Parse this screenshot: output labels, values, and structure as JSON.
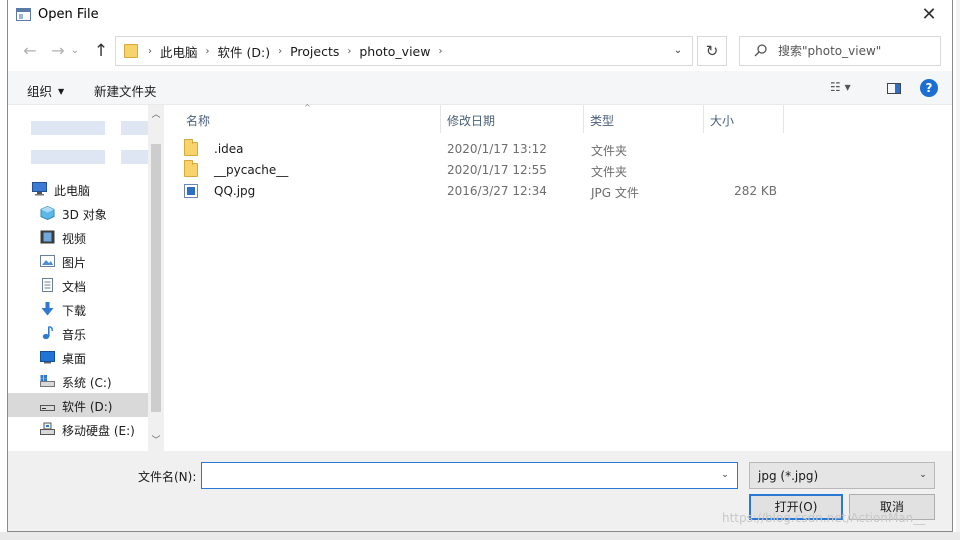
{
  "window": {
    "title": "Open File",
    "close_glyph": "✕"
  },
  "nav": {
    "back_glyph": "←",
    "forward_glyph": "→",
    "recent_glyph": "⌄",
    "up_glyph": "↑",
    "breadcrumbs": [
      "此电脑",
      "软件 (D:)",
      "Projects",
      "photo_view"
    ],
    "separator": "›",
    "dropdown_glyph": "⌄",
    "refresh_glyph": "↻",
    "search_placeholder": "搜索\"photo_view\""
  },
  "toolbar": {
    "organize": "组织",
    "new_folder": "新建文件夹",
    "view_glyph": "☷ ▾",
    "help_glyph": "?"
  },
  "sidebar": {
    "items": [
      {
        "label": "此电脑",
        "icon": "computer-icon"
      },
      {
        "label": "3D 对象",
        "icon": "3d-objects-icon"
      },
      {
        "label": "视频",
        "icon": "video-icon"
      },
      {
        "label": "图片",
        "icon": "pictures-icon"
      },
      {
        "label": "文档",
        "icon": "documents-icon"
      },
      {
        "label": "下载",
        "icon": "download-icon"
      },
      {
        "label": "音乐",
        "icon": "music-icon"
      },
      {
        "label": "桌面",
        "icon": "desktop-icon"
      },
      {
        "label": "系统 (C:)",
        "icon": "system-drive-icon"
      },
      {
        "label": "软件 (D:)",
        "icon": "drive-icon",
        "selected": true
      },
      {
        "label": "移动硬盘 (E:)",
        "icon": "removable-drive-icon"
      }
    ],
    "scroll_up": "︿",
    "scroll_down": "﹀"
  },
  "files": {
    "columns": [
      "名称",
      "修改日期",
      "类型",
      "大小"
    ],
    "sort_glyph": "^",
    "rows": [
      {
        "name": ".idea",
        "date": "2020/1/17 13:12",
        "type": "文件夹",
        "size": "",
        "icon": "folder-icon"
      },
      {
        "name": "__pycache__",
        "date": "2020/1/17 12:55",
        "type": "文件夹",
        "size": "",
        "icon": "folder-icon"
      },
      {
        "name": "QQ.jpg",
        "date": "2016/3/27 12:34",
        "type": "JPG 文件",
        "size": "282 KB",
        "icon": "image-file-icon"
      }
    ]
  },
  "footer": {
    "filename_label": "文件名(N):",
    "filename_value": "",
    "filename_dd": "⌄",
    "filter": "jpg (*.jpg)",
    "filter_dd": "⌄",
    "open": "打开(O)",
    "cancel": "取消"
  },
  "watermark": "https://blog.csdn.net/ActionMan__"
}
